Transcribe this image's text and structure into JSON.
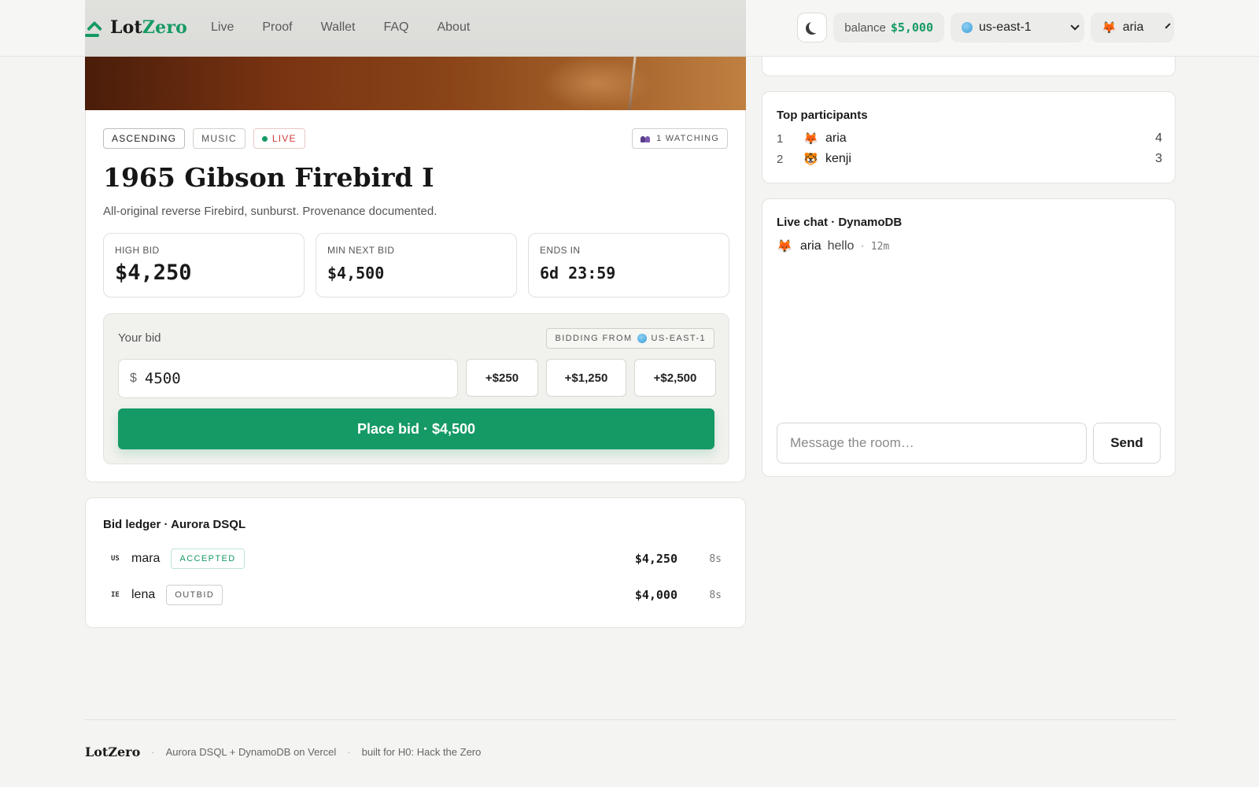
{
  "nav": {
    "brand_lot": "Lot",
    "brand_zero": "Zero",
    "links": [
      "Live",
      "Proof",
      "Wallet",
      "FAQ",
      "About"
    ],
    "balance_label": "balance",
    "balance_value": "$5,000",
    "region": "us-east-1",
    "user": "aria",
    "icons": {
      "theme": "moon-icon",
      "region": "globe-icon",
      "user": "fox-avatar"
    }
  },
  "lot": {
    "badges": {
      "type": "ASCENDING",
      "category": "MUSIC",
      "status": "LIVE"
    },
    "watching": "1 WATCHING",
    "title": "1965 Gibson Firebird I",
    "description": "All-original reverse Firebird, sunburst. Provenance documented.",
    "stats": {
      "high_bid_label": "HIGH BID",
      "high_bid": "$4,250",
      "min_next_label": "MIN NEXT BID",
      "min_next": "$4,500",
      "ends_label": "ENDS IN",
      "ends": "6d 23:59"
    },
    "bid": {
      "label": "Your bid",
      "bidding_from": "BIDDING FROM",
      "region": "US-EAST-1",
      "currency": "$",
      "value": "4500",
      "increments": [
        "+$250",
        "+$1,250",
        "+$2,500"
      ],
      "place_label": "Place bid · $4,500"
    }
  },
  "ledger": {
    "title": "Bid ledger · Aurora DSQL",
    "rows": [
      {
        "country": "US",
        "name": "mara",
        "status": "ACCEPTED",
        "amount": "$4,250",
        "age": "8s"
      },
      {
        "country": "IE",
        "name": "lena",
        "status": "OUTBID",
        "amount": "$4,000",
        "age": "8s"
      }
    ]
  },
  "participants": {
    "title": "Top participants",
    "rows": [
      {
        "rank": "1",
        "avatar": "🦊",
        "name": "aria",
        "count": "4"
      },
      {
        "rank": "2",
        "avatar": "🐯",
        "name": "kenji",
        "count": "3"
      }
    ]
  },
  "chat": {
    "title": "Live chat · DynamoDB",
    "messages": [
      {
        "avatar": "🦊",
        "author": "aria",
        "text": "hello",
        "sep": "·",
        "time": "12m"
      }
    ],
    "placeholder": "Message the room…",
    "send_label": "Send"
  },
  "footer": {
    "brand": "LotZero",
    "stack": "Aurora DSQL + DynamoDB on Vercel",
    "credit": "built for H0: Hack the Zero"
  },
  "colors": {
    "accent": "#149a63",
    "live": "#d23a3a",
    "background": "#f4f4f2"
  }
}
